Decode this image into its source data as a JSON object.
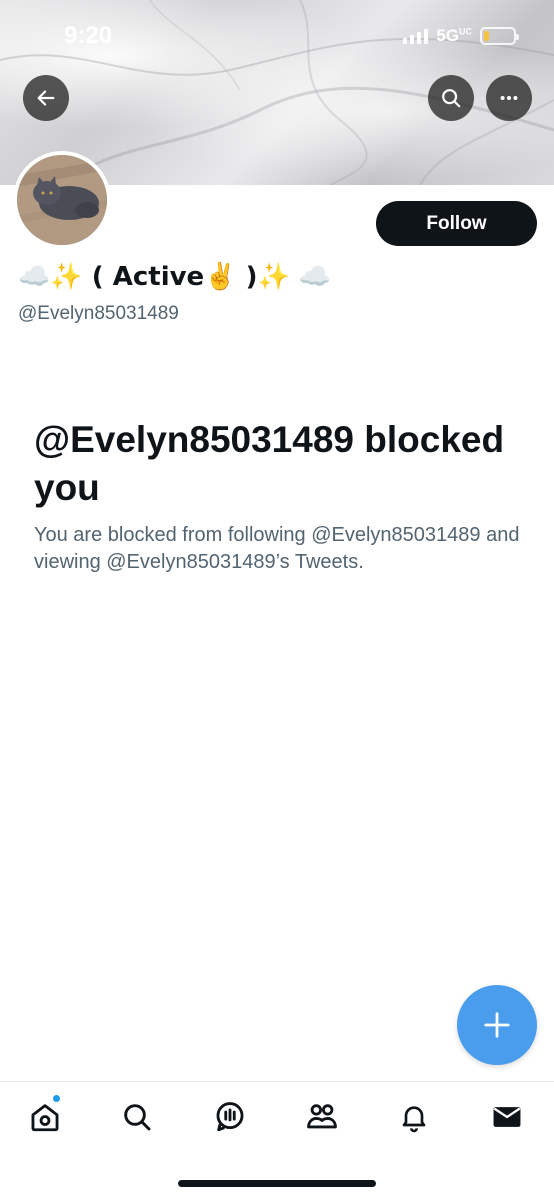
{
  "status_bar": {
    "time": "9:20",
    "network": "5G",
    "network_superscript": "UC"
  },
  "header": {
    "back_icon": "arrow-left-icon",
    "search_icon": "search-icon",
    "more_icon": "ellipsis-icon"
  },
  "profile": {
    "display_name": "☁️✨ ( Active✌️ )✨ ☁️",
    "handle": "@Evelyn85031489",
    "follow_label": "Follow"
  },
  "blocked_notice": {
    "title": "@Evelyn85031489 blocked you",
    "description": "You are blocked from following @Evelyn85031489 and viewing @Evelyn85031489’s Tweets."
  },
  "fab": {
    "icon": "plus-icon"
  },
  "tab_bar": {
    "items": [
      {
        "name": "home",
        "icon": "home-icon",
        "has_notification_dot": true
      },
      {
        "name": "search",
        "icon": "search-icon"
      },
      {
        "name": "spaces",
        "icon": "spaces-icon"
      },
      {
        "name": "communities",
        "icon": "communities-icon"
      },
      {
        "name": "notifications",
        "icon": "bell-icon"
      },
      {
        "name": "messages",
        "icon": "envelope-icon"
      }
    ]
  },
  "colors": {
    "primary_text": "#0f1419",
    "secondary_text": "#536471",
    "accent": "#1d9bf0",
    "fab": "#4a9cec"
  }
}
